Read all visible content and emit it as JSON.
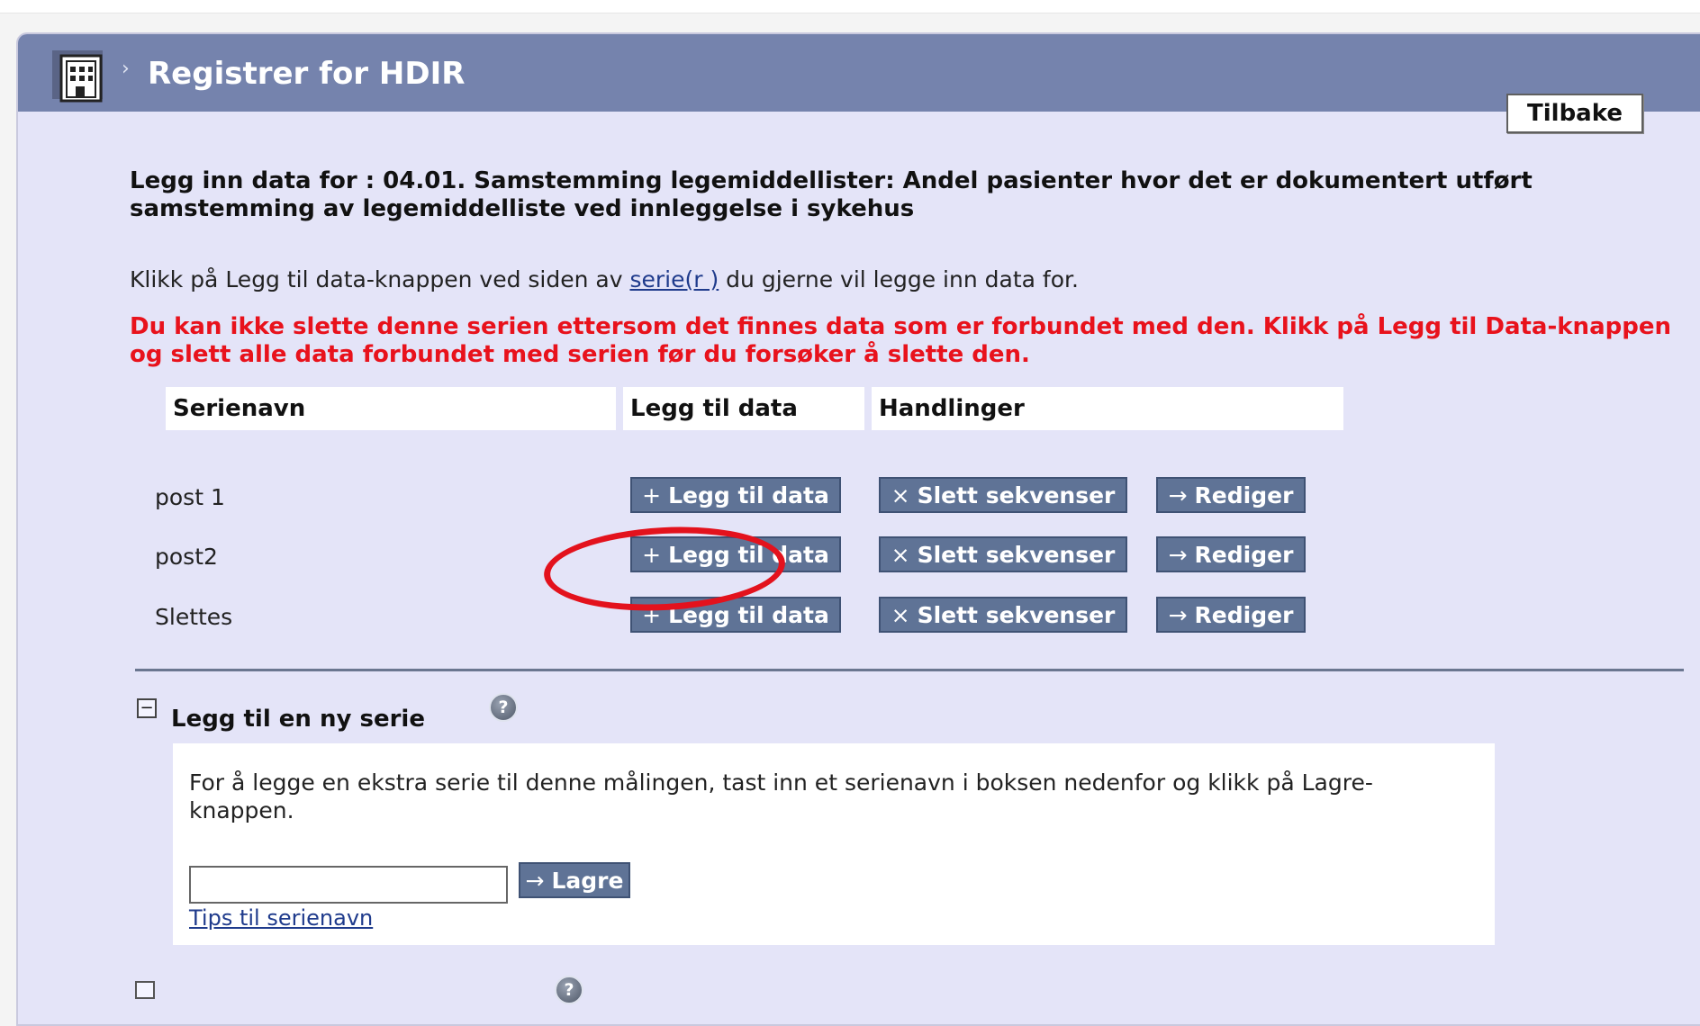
{
  "header": {
    "title": "Registrer for HDIR",
    "icon": "building-icon"
  },
  "back_label": "Tilbake",
  "intro_title": "Legg inn data for : 04.01. Samstemming legemiddellister: Andel pasienter hvor det er dokumentert utført samstemming av legemiddelliste ved innleggelse i sykehus",
  "instructions": {
    "prefix": "Klikk på Legg til data-knappen ved siden av ",
    "link": "serie(r )",
    "suffix": " du gjerne vil legge inn data for."
  },
  "warning": "Du kan ikke slette denne serien ettersom det finnes data som er forbundet med den. Klikk på Legg til Data-knappen og slett alle data forbundet med serien før du forsøker å slette den.",
  "table": {
    "columns": [
      "Serienavn",
      "Legg til data",
      "Handlinger"
    ],
    "rows": [
      {
        "name": "post 1",
        "add_label": "Legg til data",
        "delete_label": "Slett sekvenser",
        "edit_label": "Rediger"
      },
      {
        "name": "post2",
        "add_label": "Legg til data",
        "delete_label": "Slett sekvenser",
        "edit_label": "Rediger"
      },
      {
        "name": "Slettes",
        "add_label": "Legg til data",
        "delete_label": "Slett sekvenser",
        "edit_label": "Rediger"
      }
    ]
  },
  "icons": {
    "add": "+",
    "delete": "×",
    "edit": "→",
    "collapse": "−",
    "help": "?"
  },
  "new_series": {
    "title": "Legg til en ny serie",
    "description": "For å legge en ekstra serie til denne målingen, tast inn et serienavn i boksen nedenfor og klikk på Lagre-knappen.",
    "input_value": "",
    "save_label": "Lagre",
    "tips_link": "Tips til serienavn"
  },
  "colors": {
    "header": "#7583ad",
    "panel": "#e4e4f8",
    "button": "#5f7396",
    "warning": "#e8121c",
    "highlight_oval": "#e3121d"
  }
}
